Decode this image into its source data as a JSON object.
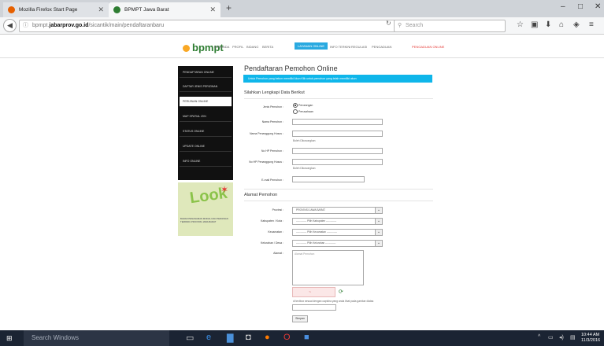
{
  "browser": {
    "tabs": [
      {
        "title": "Mozilla Firefox Start Page",
        "active": false
      },
      {
        "title": "BPMPT Jawa Barat",
        "active": true
      }
    ],
    "new_tab": "+",
    "url_prefix": "bpmpt.",
    "url_domain": "jabarprov.go.id",
    "url_path": "/sicantik/main/pendaftaranbaru",
    "search_placeholder": "Search",
    "window": {
      "minimize": "–",
      "maximize": "□",
      "close": "✕"
    }
  },
  "site": {
    "logo": "bpmpt",
    "menu": [
      "BERANDA",
      "PROFIL",
      "BIDANG",
      "BERITA",
      "LAYANAN ONLINE",
      "INFO TERKINI",
      "REGULASI",
      "PENGADUAN"
    ],
    "menu_badge": "PENGADUAN ONLINE"
  },
  "sidebar": {
    "items": [
      {
        "label": "PENDAFTARAN ONLINE",
        "active": false
      },
      {
        "label": "DAFTAR JENIS PERIZINAN",
        "active": false
      },
      {
        "label": "PERIJINAN ONLINE",
        "active": true
      },
      {
        "label": "MAP SPATIAL IZIN",
        "active": false
      },
      {
        "label": "STATUS ONLINE",
        "active": false
      },
      {
        "label": "UPDATE ONLINE",
        "active": false
      },
      {
        "label": "INFO ONLINE",
        "active": false
      }
    ],
    "promo_word": "Look",
    "promo_caption": "BADAN PENANAMAN MODAL DAN PERIJINAN TERPADU PROVINSI JAWA BARAT"
  },
  "form": {
    "title": "Pendaftaran Pemohon Online",
    "info": "Untuk Pemohon yang belum memiliki Akun Klik      untuk pemohon yang telah memiliki akun",
    "section1": "Silahkan Lengkapi Data Berikut",
    "jenis_label": "Jenis Pemohon :",
    "jenis_options": [
      "Perorangan",
      "Perusahaan"
    ],
    "nama_label": "Nama Pemohon :",
    "penanggung_label": "Nama Penanggung Husus :",
    "penanggung_note": "Boleh Dikosongkan",
    "hp_label": "No HP Pemohon :",
    "hp_pj_label": "No HP Penanggung Husus :",
    "hp_pj_note": "Boleh Dikosongkan",
    "email_label": "E-mail Pemohon :",
    "section2": "Alamat Pemohon",
    "provinsi_label": "Provinsi :",
    "provinsi_value": "PROVINSI JAWA BARAT",
    "kabupaten_label": "Kabupaten / Kota :",
    "kabupaten_value": "------------ Pilih Kabupaten ------------",
    "kecamatan_label": "Kecamatan :",
    "kecamatan_value": "------------ Pilih Kecamatan ------------",
    "kelurahan_label": "Kelurahan / Desa :",
    "kelurahan_value": "------------ Pilih Kelurahan ------------",
    "alamat_label": "Alamat :",
    "alamat_placeholder": "Alamat Pemohon",
    "captcha_note": "di textbox sesuai dengan captcha yang anda lihat pada gambar diatas",
    "submit": "Simpan"
  },
  "taskbar": {
    "search": "Search Windows",
    "time": "10:44 AM",
    "date": "11/3/2016"
  }
}
